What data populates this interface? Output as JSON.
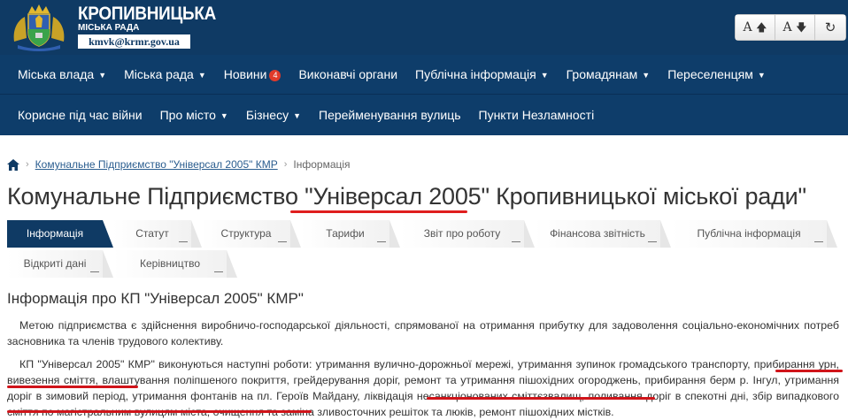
{
  "header": {
    "city_name": "КРОПИВНИЦЬКА",
    "city_sub": "МІСЬКА РАДА",
    "email": "kmvk@krmr.gov.ua",
    "font_increase": "A",
    "font_decrease": "A",
    "reset_icon": "refresh-icon"
  },
  "nav": {
    "row1": [
      {
        "label": "Міська влада",
        "caret": true
      },
      {
        "label": "Міська рада",
        "caret": true
      },
      {
        "label": "Новини",
        "badge": "4"
      },
      {
        "label": "Виконавчі органи"
      },
      {
        "label": "Публічна інформація",
        "caret": true
      },
      {
        "label": "Громадянам",
        "caret": true
      },
      {
        "label": "Переселенцям",
        "caret": true
      }
    ],
    "row2": [
      {
        "label": "Корисне під час війни"
      },
      {
        "label": "Про місто",
        "caret": true
      },
      {
        "label": "Бізнесу",
        "caret": true
      },
      {
        "label": "Перейменування вулиць"
      },
      {
        "label": "Пункти Незламності"
      }
    ]
  },
  "breadcrumb": {
    "home_icon": "home-icon",
    "link": "Комунальне Підприємство \"Універсал 2005\" КМР",
    "current": "Інформація"
  },
  "page_title": "Комунальне Підприємство \"Універсал 2005\" Кропивницької міської ради\"",
  "tabs": [
    {
      "label": "Інформація",
      "active": true
    },
    {
      "label": "Статут"
    },
    {
      "label": "Структура"
    },
    {
      "label": "Тарифи"
    },
    {
      "label": "Звіт про роботу"
    },
    {
      "label": "Фінансова звітність"
    },
    {
      "label": "Публічна інформація"
    },
    {
      "label": "Відкриті дані"
    },
    {
      "label": "Керівництво"
    }
  ],
  "content": {
    "section_title": "Інформація про КП \"Універсал 2005\" КМР\"",
    "para1": "Метою підприємства є здійснення виробничо-господарської діяльності, спрямованої на отримання прибутку для задоволення соціально-економічних потреб засновника та членів трудового колективу.",
    "para2": "КП \"Універсал 2005\" КМР\" виконуються наступні роботи: утримання вулично-дорожньої мережі,  утримання зупинок громадського транспорту, прибирання урн, вивезення сміття, влаштування поліпшеного покриття, грейдерування доріг, ремонт та утримання пішохідних огороджень, прибирання берм р. Інгул, утримання доріг в зимовий період, утримання фонтанів на пл. Героїв Майдану, ліквідація несанкціонованих сміттєзвалищ, поливання доріг в спекотні дні, збір випадкового сміття по магістральним вулицям міста, очищення та заміна зливосточних решіток та люків, ремонт пішохідних містків."
  },
  "colors": {
    "header_bg": "#0f3a64",
    "nav_bg": "#0e3d6a",
    "active_tab": "#0f3a64",
    "annotation_red": "#d0141a",
    "badge": "#e03a2a"
  }
}
